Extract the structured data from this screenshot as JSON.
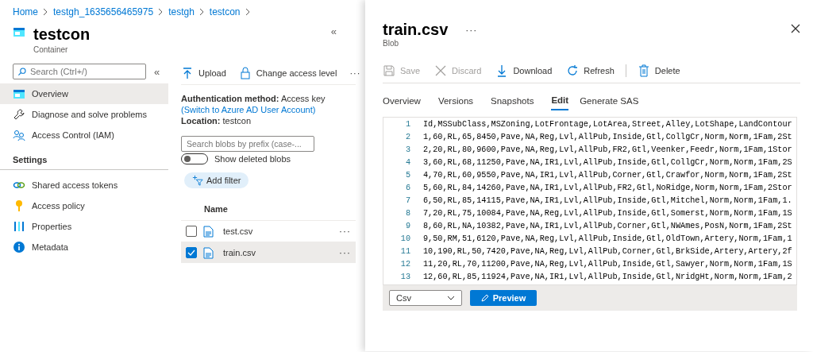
{
  "breadcrumb": [
    "Home",
    "testgh_1635656465975",
    "testgh",
    "testcon"
  ],
  "container": {
    "title": "testcon",
    "subtitle": "Container",
    "collapse": "«"
  },
  "sidebar": {
    "search": {
      "placeholder": "Search (Ctrl+/)"
    },
    "collapse": "«",
    "items": [
      {
        "label": "Overview",
        "selected": true
      },
      {
        "label": "Diagnose and solve problems",
        "selected": false
      },
      {
        "label": "Access Control (IAM)",
        "selected": false
      }
    ],
    "section": "Settings",
    "settings_items": [
      {
        "label": "Shared access tokens",
        "selected": false
      },
      {
        "label": "Access policy",
        "selected": false
      },
      {
        "label": "Properties",
        "selected": false
      },
      {
        "label": "Metadata",
        "selected": false
      }
    ]
  },
  "content": {
    "toolbar": [
      {
        "label": "Upload"
      },
      {
        "label": "Change access level"
      }
    ],
    "more": "···",
    "auth_label": "Authentication method:",
    "auth_value": "Access key",
    "auth_link": "(Switch to Azure AD User Account)",
    "location_label": "Location:",
    "location_value": "testcon",
    "blob_search": {
      "placeholder": "Search blobs by prefix (case-..."
    },
    "show_deleted": {
      "label": "Show deleted blobs",
      "on": false
    },
    "add_filter": "Add filter",
    "name_header": "Name",
    "blobs": [
      {
        "name": "test.csv",
        "checked": false,
        "more": "···"
      },
      {
        "name": "train.csv",
        "checked": true,
        "more": "···"
      }
    ]
  },
  "blob_panel": {
    "title": "train.csv",
    "more": "···",
    "subtitle": "Blob",
    "toolbar": [
      {
        "label": "Save",
        "disabled": true
      },
      {
        "label": "Discard",
        "disabled": true
      },
      {
        "label": "Download",
        "disabled": false
      },
      {
        "label": "Refresh",
        "disabled": false
      },
      {
        "label": "Delete",
        "disabled": false
      }
    ],
    "tabs": [
      {
        "label": "Overview",
        "selected": false
      },
      {
        "label": "Versions",
        "selected": false
      },
      {
        "label": "Snapshots",
        "selected": false
      },
      {
        "label": "Edit",
        "selected": true
      },
      {
        "label": "Generate SAS",
        "selected": false
      }
    ],
    "editor_lines": [
      {
        "number": "1",
        "text": "Id,MSSubClass,MSZoning,LotFrontage,LotArea,Street,Alley,LotShape,LandContour"
      },
      {
        "number": "2",
        "text": "1,60,RL,65,8450,Pave,NA,Reg,Lvl,AllPub,Inside,Gtl,CollgCr,Norm,Norm,1Fam,2St"
      },
      {
        "number": "3",
        "text": "2,20,RL,80,9600,Pave,NA,Reg,Lvl,AllPub,FR2,Gtl,Veenker,Feedr,Norm,1Fam,1Stor"
      },
      {
        "number": "4",
        "text": "3,60,RL,68,11250,Pave,NA,IR1,Lvl,AllPub,Inside,Gtl,CollgCr,Norm,Norm,1Fam,2S"
      },
      {
        "number": "5",
        "text": "4,70,RL,60,9550,Pave,NA,IR1,Lvl,AllPub,Corner,Gtl,Crawfor,Norm,Norm,1Fam,2St"
      },
      {
        "number": "6",
        "text": "5,60,RL,84,14260,Pave,NA,IR1,Lvl,AllPub,FR2,Gtl,NoRidge,Norm,Norm,1Fam,2Stor"
      },
      {
        "number": "7",
        "text": "6,50,RL,85,14115,Pave,NA,IR1,Lvl,AllPub,Inside,Gtl,Mitchel,Norm,Norm,1Fam,1."
      },
      {
        "number": "8",
        "text": "7,20,RL,75,10084,Pave,NA,Reg,Lvl,AllPub,Inside,Gtl,Somerst,Norm,Norm,1Fam,1S"
      },
      {
        "number": "9",
        "text": "8,60,RL,NA,10382,Pave,NA,IR1,Lvl,AllPub,Corner,Gtl,NWAmes,PosN,Norm,1Fam,2St"
      },
      {
        "number": "10",
        "text": "9,50,RM,51,6120,Pave,NA,Reg,Lvl,AllPub,Inside,Gtl,OldTown,Artery,Norm,1Fam,1"
      },
      {
        "number": "11",
        "text": "10,190,RL,50,7420,Pave,NA,Reg,Lvl,AllPub,Corner,Gtl,BrkSide,Artery,Artery,2f"
      },
      {
        "number": "12",
        "text": "11,20,RL,70,11200,Pave,NA,Reg,Lvl,AllPub,Inside,Gtl,Sawyer,Norm,Norm,1Fam,1S"
      },
      {
        "number": "13",
        "text": "12,60,RL,85,11924,Pave,NA,IR1,Lvl,AllPub,Inside,Gtl,NridgHt,Norm,Norm,1Fam,2"
      }
    ],
    "format": "Csv",
    "preview": "Preview"
  }
}
